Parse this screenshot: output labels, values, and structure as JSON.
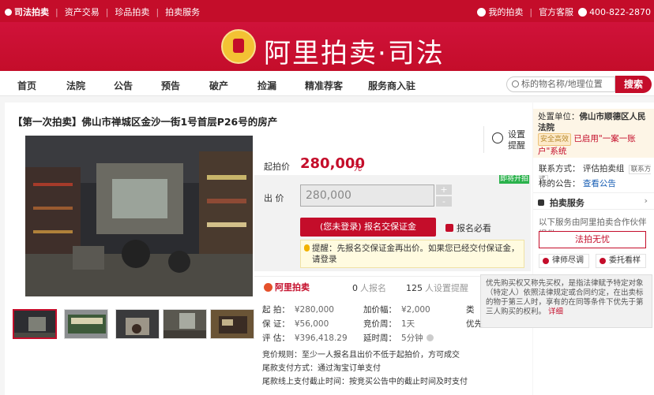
{
  "topbar": {
    "logo": "司法拍卖",
    "links": [
      "资产交易",
      "珍品拍卖",
      "拍卖服务"
    ],
    "my_auction": "我的拍卖",
    "service": "官方客服",
    "phone": "400-822-2870"
  },
  "banner": {
    "brand": "阿里拍卖·司法"
  },
  "nav": {
    "items": [
      "首页",
      "法院",
      "公告",
      "预告",
      "破产",
      "捡漏",
      "精准荐客",
      "服务商入驻"
    ],
    "search_placeholder": "标的物名称/地理位置",
    "search_button": "搜索"
  },
  "lot": {
    "title": "【第一次拍卖】佛山市禅城区金沙一街1号首层P26号的房产",
    "remind_label": "设置提醒",
    "start_price_label": "起拍价",
    "start_price": "280,000",
    "price_unit": "元",
    "status_tag": "即将开拍",
    "bid_label": "出  价",
    "bid_value": "280,000",
    "stepper_plus": "+",
    "stepper_minus": "-",
    "deposit_button": "(您未登录) 报名交保证金",
    "must_read": "报名必看",
    "hint": "提醒：先报名交保证金再出价。如果您已经交付保证金，请登录"
  },
  "stats": {
    "brand": "阿里拍卖",
    "signup_count": "0",
    "signup_label": "人报名",
    "reminder_count": "125",
    "reminder_label": "人设置提醒"
  },
  "details": {
    "start_price_k": "起  拍：",
    "start_price_v": "¥280,000",
    "increment_k": "加价幅：",
    "increment_v": "¥2,000",
    "deposit_k": "保  证：",
    "deposit_v": "¥56,000",
    "period_k": "竞价周：",
    "period_v": "1天",
    "appraisal_k": "评  估：",
    "appraisal_v": "¥396,418.29",
    "delay_k": "延时周：",
    "delay_v": "5分钟",
    "category_k1": "类",
    "category_k2": "优先",
    "rules": [
      "竞价规则：至少一人报名且出价不低于起拍价，方可成交",
      "尾款支付方式：通过淘宝订单支付",
      "尾款线上支付截止时间：按竞买公告中的截止时间及时支付"
    ]
  },
  "side": {
    "org_label": "处置单位：",
    "org_name": "佛山市顺德区人民法院",
    "sec_badge": "安全高效",
    "org_note": "已启用\"一案一账户\"系统",
    "contact_label": "联系方式：",
    "contact_value": "评估拍卖组",
    "contact_badge": "联系方式",
    "notice_label": "标的公告：",
    "notice_link": "查看公告",
    "service_title": "拍卖服务",
    "service_note": "以下服务由阿里拍卖合作伙伴提供",
    "legal_button": "法拍无忧",
    "lawyer": "律师尽调",
    "entrust": "委托看样"
  },
  "tooltip": {
    "text": "优先购买权又称先买权，是指法律赋予特定对象（特定人）依照法律规定或合同约定，在出卖标的物于第三人时，享有的在同等条件下优先于第三人购买的权利。",
    "detail": "详细"
  },
  "colors": {
    "brand_red": "#c40d2a",
    "green_tag": "#2bb24c"
  }
}
